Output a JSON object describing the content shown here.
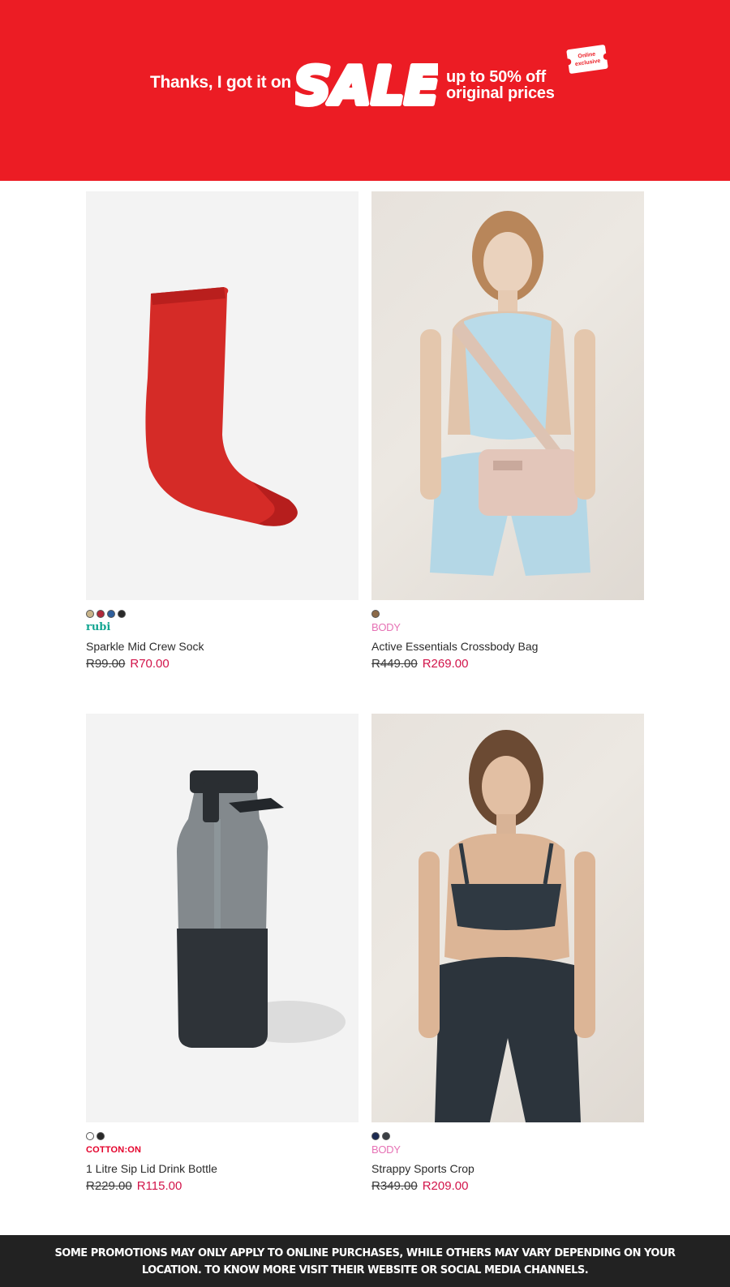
{
  "banner": {
    "thanks": "Thanks, I got it on",
    "sale": "SALE",
    "offer_line1": "up to 50% off",
    "offer_line2": "original prices",
    "tag_line1": "Online",
    "tag_line2": "exclusive",
    "color": "#ec1c24"
  },
  "products": [
    {
      "image": "red-sock",
      "swatches": [
        "#c8b48a",
        "#b1293a",
        "#2f5f9c",
        "#2a2a2a"
      ],
      "brand": "rubi",
      "name": "Sparkle Mid Crew Sock",
      "price_was": "R99.00",
      "price_now": "R70.00"
    },
    {
      "image": "crossbody-bag-model",
      "swatches": [
        "#8c6a48"
      ],
      "brand": "BODY",
      "name": "Active Essentials Crossbody Bag",
      "price_was": "R449.00",
      "price_now": "R269.00"
    },
    {
      "image": "drink-bottle",
      "swatches": [
        "#ffffff",
        "#2a2a2a"
      ],
      "brand": "COTTON:ON",
      "name": "1 Litre Sip Lid Drink Bottle",
      "price_was": "R229.00",
      "price_now": "R115.00"
    },
    {
      "image": "sports-crop-model",
      "swatches": [
        "#1c2a52",
        "#3b3f45"
      ],
      "brand": "BODY",
      "name": "Strappy Sports Crop",
      "price_was": "R349.00",
      "price_now": "R209.00"
    }
  ],
  "footer": {
    "text": "SOME PROMOTIONS MAY ONLY APPLY TO ONLINE PURCHASES, WHILE OTHERS MAY VARY DEPENDING ON YOUR LOCATION. TO KNOW MORE VISIT THEIR WEBSITE OR SOCIAL MEDIA CHANNELS."
  }
}
